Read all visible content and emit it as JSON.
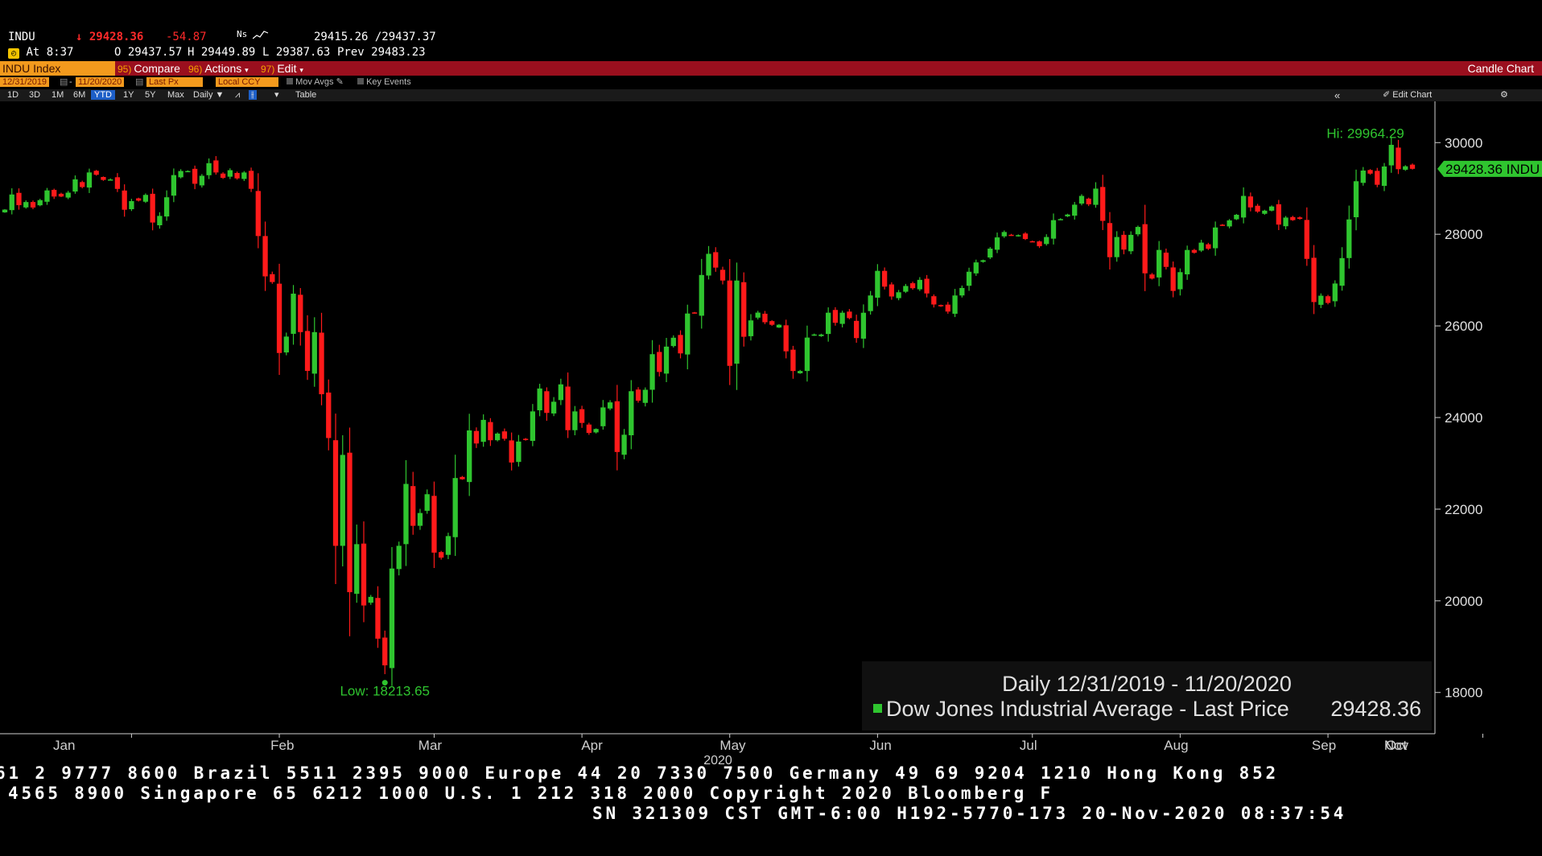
{
  "header": {
    "ticker": "INDU",
    "last": "29428.36",
    "change": "-54.87",
    "spark_label": "Ns",
    "bid_ask": "29415.26 /29437.37",
    "at_time": "At 8:37",
    "open_label": "O",
    "open": "29437.57",
    "high_label": "H",
    "high": "29449.89",
    "low_label": "L",
    "low": "29387.63",
    "prev_label": "Prev",
    "prev": "29483.23"
  },
  "toolbar": {
    "security": "INDU Index",
    "compare_num": "95)",
    "compare": "Compare",
    "actions_num": "96)",
    "actions": "Actions",
    "edit_num": "97)",
    "edit": "Edit",
    "chart_type": "Candle Chart"
  },
  "range": {
    "start": "12/31/2019",
    "end": "11/20/2020",
    "field": "Last Px",
    "currency": "Local CCY",
    "mov_avgs": "Mov Avgs",
    "key_events": "Key Events"
  },
  "periods": {
    "items": [
      "1D",
      "3D",
      "1M",
      "6M",
      "YTD",
      "1Y",
      "5Y",
      "Max"
    ],
    "active": "YTD",
    "frequency": "Daily",
    "table": "Table",
    "edit_chart": "Edit Chart"
  },
  "chart_data": {
    "type": "candlestick",
    "y_ticks": [
      18000,
      20000,
      22000,
      24000,
      26000,
      28000,
      30000
    ],
    "ylim": [
      17100,
      30900
    ],
    "x_labels": [
      "Jan",
      "Feb",
      "Mar",
      "Apr",
      "May",
      "Jun",
      "Jul",
      "Aug",
      "Sep",
      "Oct",
      "Nov"
    ],
    "year_label": "2020",
    "hi_label": "Hi: 29964.29",
    "low_label": "Low: 18213.65",
    "hi_value": 29964.29,
    "low_value": 18213.65,
    "last_tag": "29428.36 INDU",
    "last_value": 29428.36,
    "legend_title": "Daily 12/31/2019 - 11/20/2020",
    "legend_series": "Dow Jones Industrial Average - Last Price",
    "legend_value": "29428.36",
    "up_color": "#2fc52f",
    "down_color": "#ff1a1a",
    "closes": [
      28538,
      28868,
      28634,
      28703,
      28584,
      28745,
      28957,
      28823,
      28824,
      28908,
      29198,
      29031,
      29349,
      29298,
      29186,
      29196,
      28990,
      28535,
      28723,
      28734,
      28859,
      28256,
      28400,
      28807,
      29291,
      29380,
      29380,
      29102,
      29276,
      29551,
      29348,
      29232,
      29398,
      29219,
      29348,
      28992,
      27961,
      27081,
      26957,
      25409,
      25767,
      26703,
      25865,
      25018,
      25864,
      24509,
      23553,
      21200,
      23185,
      20189,
      21237,
      19899,
      20087,
      19174,
      18592,
      20705,
      21201,
      22552,
      21637,
      21917,
      22327,
      21052,
      20943,
      21413,
      22680,
      22653,
      23719,
      23434,
      23949,
      23505,
      23650,
      23537,
      23019,
      23476,
      23515,
      24134,
      24634,
      24101,
      24345,
      24724,
      23724,
      24134,
      23883,
      23664,
      23750,
      24221,
      24331,
      23248,
      23625,
      24575,
      24368,
      24606,
      25383,
      24995,
      25548,
      25742,
      25400,
      26270,
      26282,
      27111,
      27573,
      27272,
      26990,
      25128,
      26990,
      25763,
      26120,
      26290,
      26080,
      26025,
      26025,
      25445,
      25015,
      25016,
      25745,
      25813,
      25812,
      26288,
      26068,
      26288,
      26170,
      25734,
      26287,
      26664,
      27201,
      26857,
      26642,
      26734,
      26871,
      26823,
      27005,
      26708,
      26467,
      26428,
      26313,
      26664,
      26828,
      27182,
      27386,
      27433,
      27686,
      27931,
      28049,
      27979,
      27980,
      27896,
      27844,
      27739,
      27940,
      28308,
      28331,
      28430,
      28645,
      28837,
      28654,
      28996,
      28292,
      27500,
      27940,
      27665,
      27987,
      28160,
      27147,
      27033,
      27658,
      27288,
      26763,
      27173,
      27657,
      27596,
      27817,
      27683,
      28148,
      28195,
      28303,
      28425,
      28837,
      28586,
      28495,
      28515,
      28606,
      28211,
      28364,
      28308,
      28336,
      27463,
      26520,
      26659,
      26502,
      26925,
      27480,
      28323,
      29157,
      29390,
      29323,
      29080,
      29479,
      29951,
      29420,
      29483,
      29428
    ]
  },
  "footer": {
    "line1": "61 2 9777 8600 Brazil 5511 2395 9000 Europe 44 20 7330 7500 Germany 49 69 9204 1210 Hong Kong 852",
    "line2": "4565 8900      Singapore 65 6212 1000      U.S. 1 212 318 2000      Copyright 2020 Bloomberg F",
    "line3": "SN 321309 CST  GMT-6:00 H192-5770-173 20-Nov-2020 08:37:54"
  }
}
